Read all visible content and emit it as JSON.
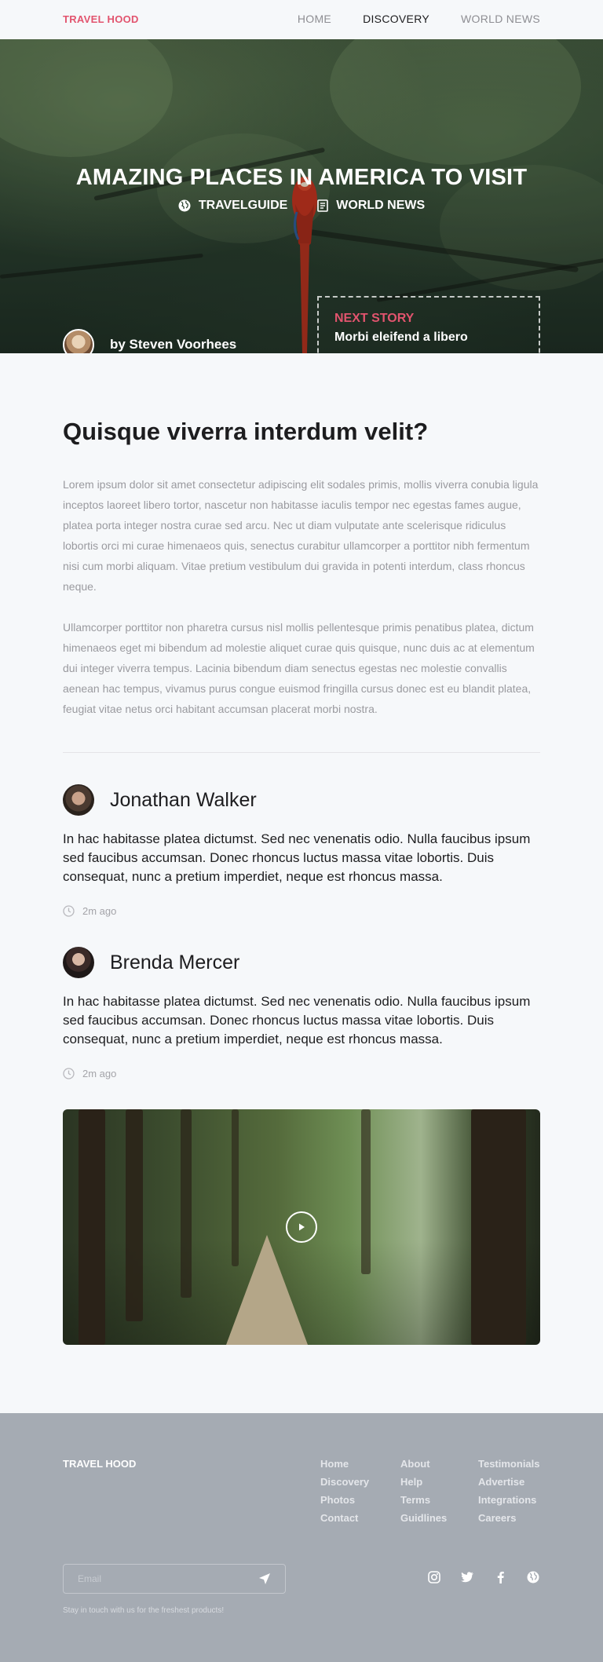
{
  "brand": "TRAVEL HOOD",
  "nav": {
    "items": [
      {
        "label": "HOME",
        "active": false
      },
      {
        "label": "DISCOVERY",
        "active": true
      },
      {
        "label": "WORLD NEWS",
        "active": false
      }
    ]
  },
  "hero": {
    "title": "AMAZING PLACES IN AMERICA TO VISIT",
    "tags": [
      {
        "label": "TRAVELGUIDE",
        "icon": "globe-icon"
      },
      {
        "label": "WORLD NEWS",
        "icon": "document-icon"
      }
    ],
    "author": "by Steven Voorhees",
    "next_story": {
      "label": "NEXT STORY",
      "title": "Morbi eleifend a libero"
    }
  },
  "article": {
    "heading": "Quisque viverra interdum velit?",
    "paragraphs": [
      "Lorem ipsum dolor sit amet consectetur adipiscing elit sodales primis, mollis viverra conubia ligula inceptos laoreet libero tortor, nascetur non habitasse iaculis tempor nec egestas fames augue, platea porta integer nostra curae sed arcu. Nec ut diam vulputate ante scelerisque ridiculus lobortis orci mi curae himenaeos quis, senectus curabitur ullamcorper a porttitor nibh fermentum nisi cum morbi aliquam. Vitae pretium vestibulum dui gravida in potenti interdum, class rhoncus neque.",
      "Ullamcorper porttitor non pharetra cursus nisl mollis pellentesque primis penatibus platea, dictum himenaeos eget mi bibendum ad molestie aliquet curae quis quisque, nunc duis ac at elementum dui integer viverra tempus. Lacinia bibendum diam senectus egestas nec molestie convallis aenean hac tempus, vivamus purus congue euismod fringilla cursus donec est eu blandit platea, feugiat vitae netus orci habitant accumsan placerat morbi nostra."
    ]
  },
  "comments": [
    {
      "name": "Jonathan Walker",
      "body": "In hac habitasse platea dictumst. Sed nec venenatis odio. Nulla faucibus ipsum sed faucibus accumsan. Donec rhoncus luctus massa vitae lobortis. Duis consequat, nunc a pretium imperdiet, neque est rhoncus massa.",
      "time": "2m ago"
    },
    {
      "name": "Brenda Mercer",
      "body": "In hac habitasse platea dictumst. Sed nec venenatis odio. Nulla faucibus ipsum sed faucibus accumsan. Donec rhoncus luctus massa vitae lobortis. Duis consequat, nunc a pretium imperdiet, neque est rhoncus massa.",
      "time": "2m ago"
    }
  ],
  "footer": {
    "brand": "TRAVEL HOOD",
    "columns": [
      [
        "Home",
        "Discovery",
        "Photos",
        "Contact"
      ],
      [
        "About",
        "Help",
        "Terms",
        "Guidlines"
      ],
      [
        "Testimonials",
        "Advertise",
        "Integrations",
        "Careers"
      ]
    ],
    "email_placeholder": "Email",
    "note": "Stay in touch with us for the freshest products!",
    "socials": [
      "instagram-icon",
      "twitter-icon",
      "facebook-icon",
      "globe-icon"
    ]
  },
  "colors": {
    "accent": "#e2546e",
    "background": "#f6f8fa",
    "footer": "#a5abb3"
  }
}
